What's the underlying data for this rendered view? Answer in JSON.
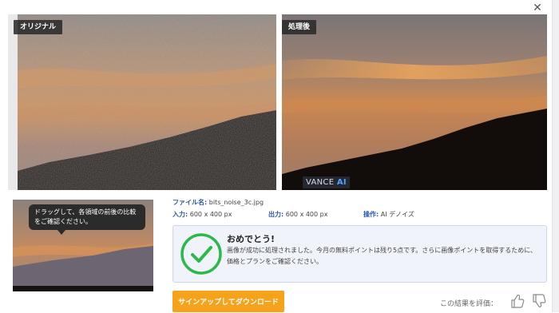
{
  "labels": {
    "original": "オリジナル",
    "processed": "処理後",
    "watermark_brand": "VANCE",
    "watermark_ai": "AI"
  },
  "tooltip": "ドラッグして、各領域の前後の比較をご確認ください。",
  "file": {
    "name_label": "ファイル名:",
    "name_value": "bits_noise_3c.jpg",
    "input_label": "入力:",
    "input_value": "600 x 400 px",
    "output_label": "出力:",
    "output_value": "600 x 400 px",
    "op_label": "操作:",
    "op_value": "AI デノイズ"
  },
  "success": {
    "title": "おめでとう!",
    "message": "画像が成功に処理されました。今月の無料ポイントは残り5点です。さらに画像ポイントを取得するために、価格とプランをご確認ください。"
  },
  "actions": {
    "signup_download": "サインアップしてダウンロード",
    "rate_prompt": "この結果を評価："
  },
  "colors": {
    "accent_orange": "#f6a21a",
    "success_green": "#2db84c",
    "label_blue": "#2a57a6"
  },
  "icons": [
    "close-icon",
    "check-circle-icon",
    "thumbs-up-icon",
    "thumbs-down-icon"
  ]
}
